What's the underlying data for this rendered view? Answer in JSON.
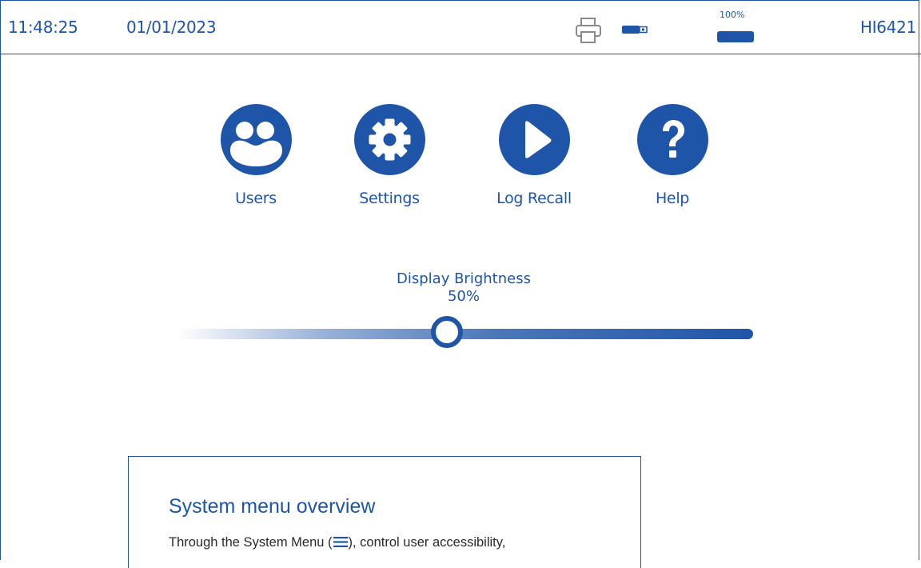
{
  "status_bar": {
    "time": "11:48:25",
    "date": "01/01/2023",
    "printer_icon": "printer-icon",
    "usb_icon": "usb-icon",
    "battery_percent": "100%",
    "battery_icon": "battery-icon",
    "model": "HI6421"
  },
  "menu": {
    "items": [
      {
        "label": "Users",
        "icon": "users-icon"
      },
      {
        "label": "Settings",
        "icon": "gear-icon"
      },
      {
        "label": "Log Recall",
        "icon": "play-icon"
      },
      {
        "label": "Help",
        "icon": "question-icon"
      }
    ]
  },
  "brightness": {
    "title": "Display Brightness",
    "value_text": "50%",
    "value": 0.5
  },
  "callout": {
    "title": "System menu overview",
    "body_before": "Through the System Menu (",
    "body_icon": "hamburger-menu-icon",
    "body_after": "), control user accessibility,"
  },
  "colors": {
    "accent": "#1f55a8",
    "background": "#ffffff",
    "body_text": "#2a2a2a"
  }
}
